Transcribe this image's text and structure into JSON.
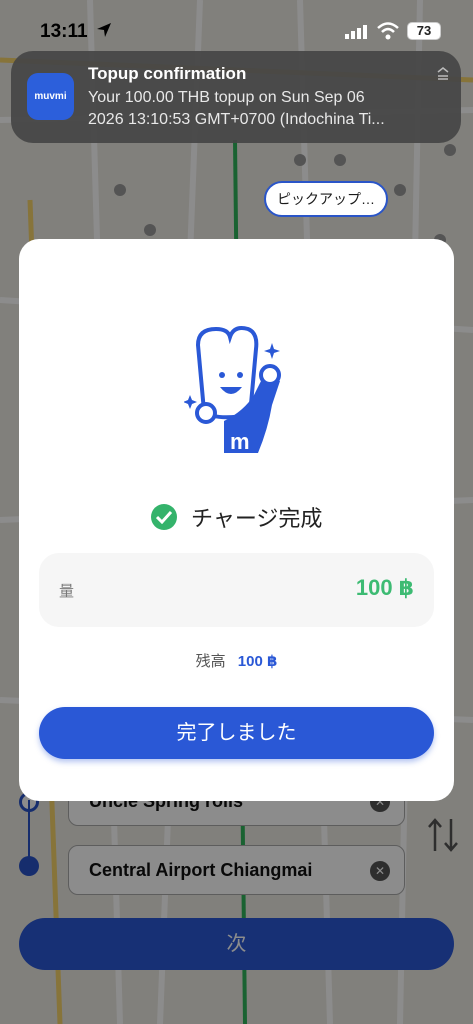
{
  "status_bar": {
    "time": "13:11",
    "battery": "73"
  },
  "notification": {
    "app_name": "muvmi",
    "title": "Topup confirmation",
    "body_line1": "Your 100.00 THB topup on Sun Sep 06",
    "body_line2": "2026 13:10:53 GMT+0700 (Indochina Ti..."
  },
  "map": {
    "pickup_label": "ピックアップ…"
  },
  "route": {
    "origin": "Uncle Spring rolls",
    "destination": "Central Airport Chiangmai",
    "next_label": "次"
  },
  "modal": {
    "done_text": "チャージ完成",
    "amount_label": "量",
    "amount_value": "100 ฿",
    "balance_label": "残高",
    "balance_value": "100 ฿",
    "finish_button": "完了しました"
  },
  "colors": {
    "primary": "#2a58d6",
    "success": "#3dbb73"
  }
}
